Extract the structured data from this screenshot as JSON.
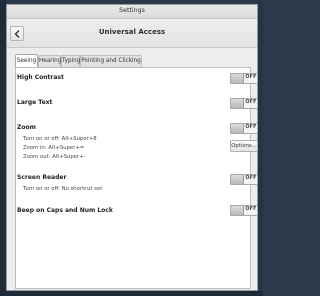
{
  "window": {
    "title": "Settings",
    "heading": "Universal Access"
  },
  "tabs": [
    {
      "label": "Seeing",
      "active": true
    },
    {
      "label": "Hearing",
      "active": false
    },
    {
      "label": "Typing",
      "active": false
    },
    {
      "label": "Pointing and Clicking",
      "active": false
    }
  ],
  "settings": {
    "high_contrast": {
      "label": "High Contrast",
      "state": "OFF"
    },
    "large_text": {
      "label": "Large Text",
      "state": "OFF"
    },
    "zoom": {
      "label": "Zoom",
      "state": "OFF",
      "shortcuts": [
        "Turn on or off:  Alt+Super+8",
        "Zoom in:  Alt+Super+=",
        "Zoom out:  Alt+Super+-"
      ],
      "options_label": "Options..."
    },
    "screen_reader": {
      "label": "Screen Reader",
      "state": "OFF",
      "shortcut": "Turn on or off:  No shortcut set"
    },
    "beep_caps": {
      "label": "Beep on Caps and Num Lock",
      "state": "OFF"
    }
  },
  "icons": {
    "back": "chevron-left-icon"
  }
}
